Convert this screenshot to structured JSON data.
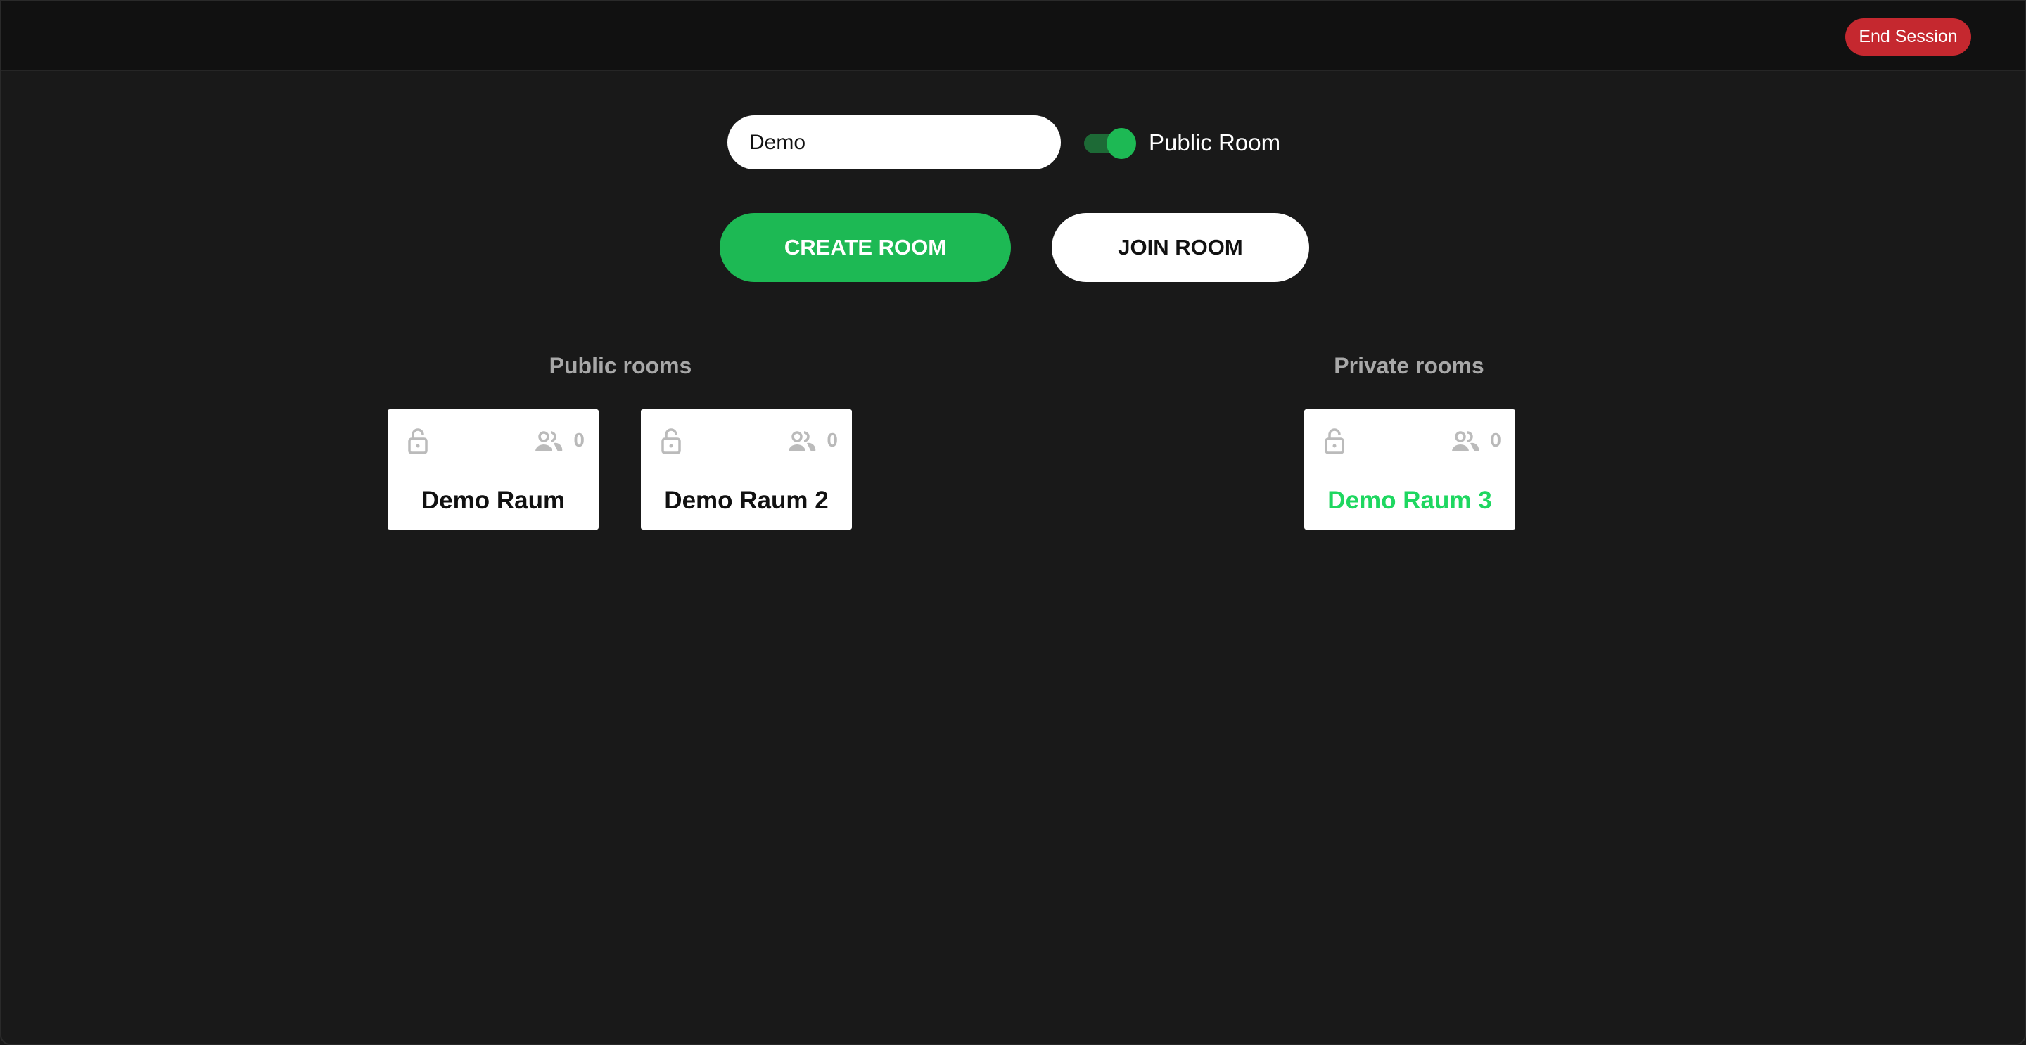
{
  "header": {
    "end_session_label": "End Session"
  },
  "form": {
    "room_name_value": "Demo",
    "public_toggle_label": "Public Room",
    "public_toggle_on": true,
    "create_label": "CREATE ROOM",
    "join_label": "JOIN ROOM"
  },
  "public_rooms": {
    "heading": "Public rooms",
    "rooms": [
      {
        "name": "Demo Raum",
        "users": "0"
      },
      {
        "name": "Demo Raum 2",
        "users": "0"
      }
    ]
  },
  "private_rooms": {
    "heading": "Private rooms",
    "rooms": [
      {
        "name": "Demo Raum 3",
        "users": "0"
      }
    ]
  },
  "colors": {
    "accent": "#1db954",
    "danger": "#c5282f",
    "highlight": "#1ed760"
  }
}
